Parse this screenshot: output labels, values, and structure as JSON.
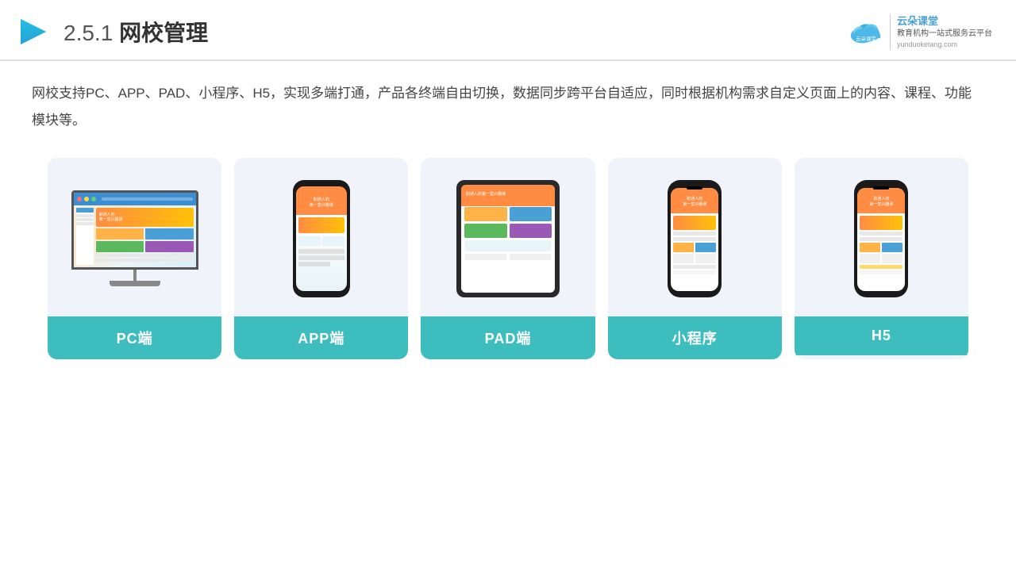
{
  "header": {
    "title": "网校管理",
    "title_prefix": "2.5.1",
    "brand": {
      "name": "云朵课堂",
      "url": "yunduoketang.com",
      "tagline": "教育机构一站式服务云平台"
    }
  },
  "description": {
    "text": "网校支持PC、APP、PAD、小程序、H5，实现多端打通，产品各终端自由切换，数据同步跨平台自适应，同时根据机构需求自定义页面上的内容、课程、功能模块等。"
  },
  "cards": [
    {
      "id": "pc",
      "label": "PC端"
    },
    {
      "id": "app",
      "label": "APP端"
    },
    {
      "id": "pad",
      "label": "PAD端"
    },
    {
      "id": "miniprogram",
      "label": "小程序"
    },
    {
      "id": "h5",
      "label": "H5"
    }
  ],
  "accent_color": "#3dbdbd"
}
